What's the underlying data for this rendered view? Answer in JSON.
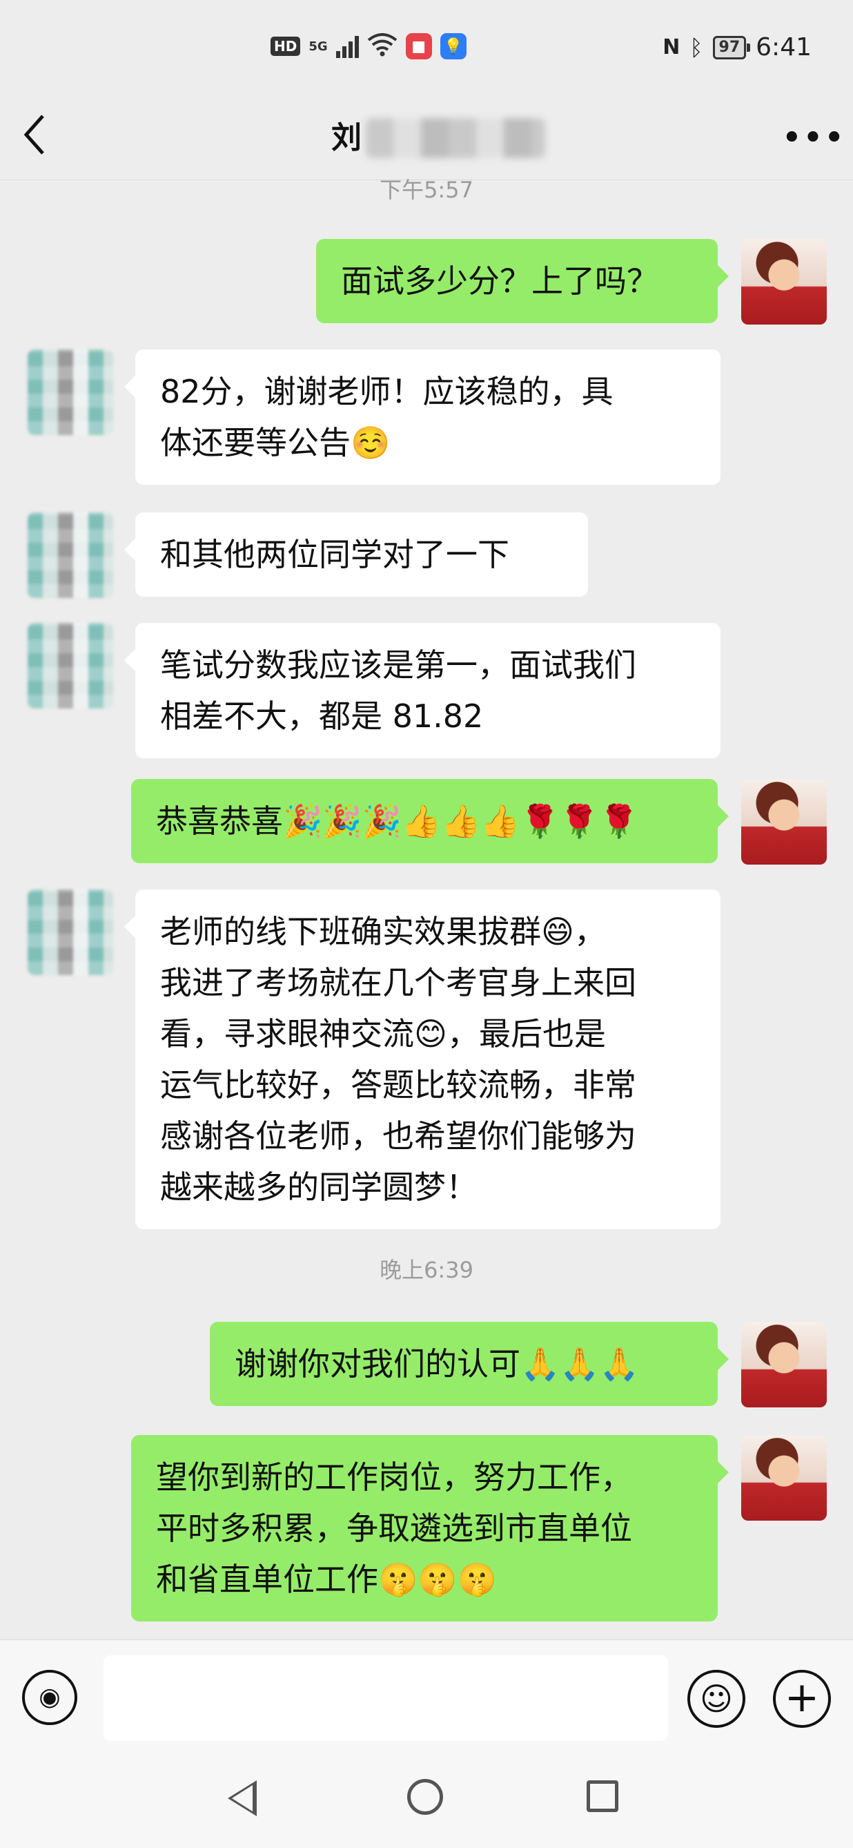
{
  "status_bar": {
    "left_badges": [
      "HD",
      "5G"
    ],
    "time": "6:41",
    "battery": "97"
  },
  "header": {
    "title_visible": "刘",
    "back_icon": "chevron-left-icon",
    "more_icon": "more-dots-icon"
  },
  "chat": {
    "top_timestamp": "下午5:57",
    "second_timestamp": "晚上6:39",
    "messages": [
      {
        "from": "me",
        "text": "面试多少分？上了吗？"
      },
      {
        "from": "them",
        "line1": "82分，谢谢老师！应该稳的，具",
        "line2": "体还要等公告☺️"
      },
      {
        "from": "them",
        "text": "和其他两位同学对了一下"
      },
      {
        "from": "them",
        "line1": "笔试分数我应该是第一，面试我们",
        "line2": "相差不大，都是 81.82"
      },
      {
        "from": "me",
        "text": "恭喜恭喜🎉🎉🎉👍👍👍🌹🌹🌹"
      },
      {
        "from": "them",
        "lines": [
          "老师的线下班确实效果拔群😄，",
          "我进了考场就在几个考官身上来回",
          "看，寻求眼神交流😊，最后也是",
          "运气比较好，答题比较流畅，非常",
          "感谢各位老师，也希望你们能够为",
          "越来越多的同学圆梦！"
        ]
      },
      {
        "from": "me",
        "text": "谢谢你对我们的认可🙏🙏🙏"
      },
      {
        "from": "me",
        "lines": [
          "望你到新的工作岗位，努力工作，",
          "平时多积累，争取遴选到市直单位",
          "和省直单位工作🤫🤫🤫"
        ]
      }
    ]
  },
  "input_bar": {
    "voice_icon": "voice-icon",
    "emoji_icon": "emoji-icon",
    "plus_icon": "plus-icon"
  },
  "colors": {
    "background": "#ededed",
    "outgoing_bubble": "#95ec69",
    "incoming_bubble": "#ffffff"
  }
}
